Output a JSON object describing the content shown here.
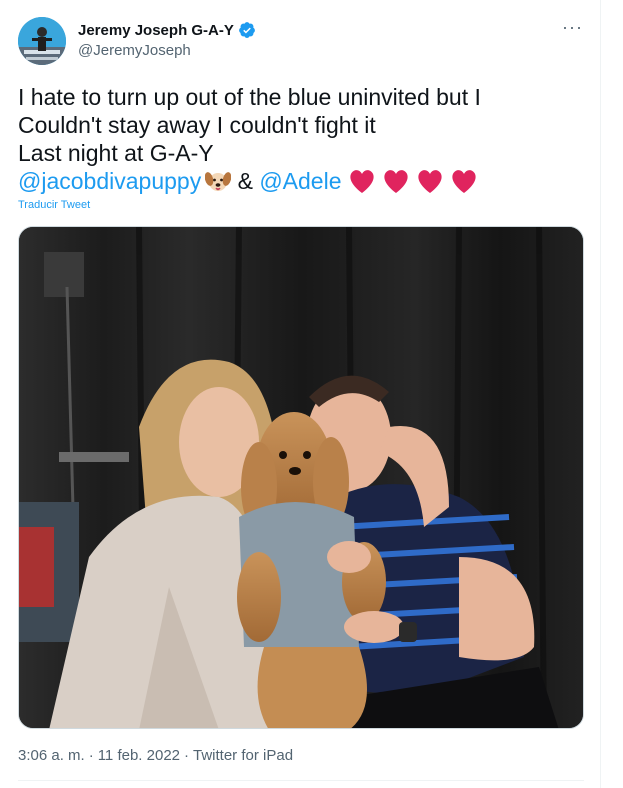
{
  "author": {
    "display_name": "Jeremy Joseph G-A-Y",
    "handle": "@JeremyJoseph",
    "verified": true
  },
  "more_options": "···",
  "tweet": {
    "line1": "I hate to turn up out of the blue uninvited but I",
    "line2": "Couldn't stay away I couldn't fight it",
    "line3": "Last night at G-A-Y",
    "mention1": "@jacobdivapuppy",
    "ampersand": "&",
    "mention2": "@Adele",
    "emojis": [
      "dog-face",
      "red-heart",
      "red-heart",
      "red-heart",
      "red-heart"
    ]
  },
  "translate_label": "Traducir Tweet",
  "meta": {
    "time": "3:06 a. m.",
    "separator": "·",
    "date": "11 feb. 2022",
    "source": "Twitter for iPad"
  },
  "colors": {
    "link": "#1d9bf0",
    "secondary_text": "#536471",
    "heart": "#e0245e"
  }
}
